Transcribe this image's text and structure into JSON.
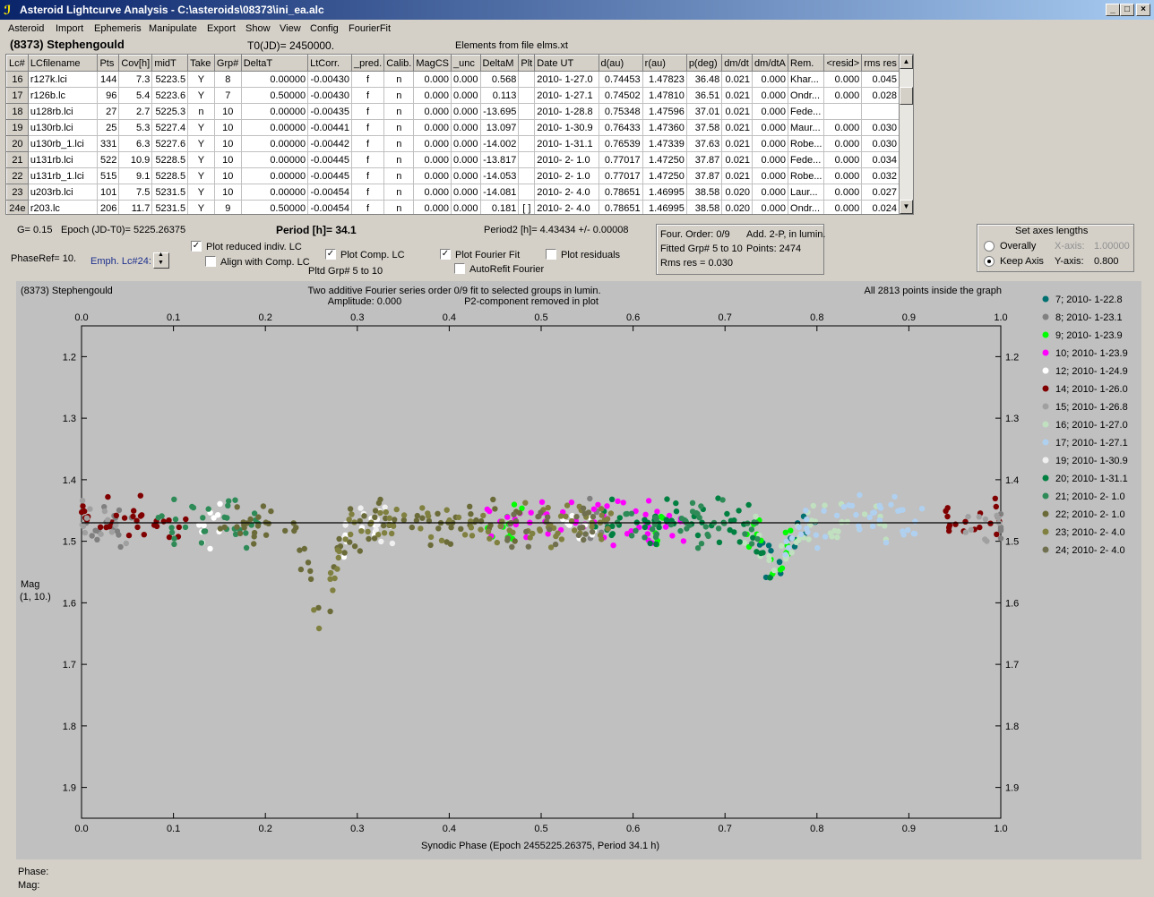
{
  "window": {
    "title": "Asteroid Lightcurve Analysis - C:\\asteroids\\08373\\ini_ea.alc",
    "min_label": "_",
    "max_label": "□",
    "close_label": "×"
  },
  "menu": [
    "Asteroid",
    "Import",
    "Ephemeris",
    "Manipulate",
    "Export",
    "Show",
    "View",
    "Config",
    "FourierFit"
  ],
  "header": {
    "asteroid": "(8373) Stephengould",
    "t0": "T0(JD)= 2450000.",
    "elements": "Elements from file elms.xt"
  },
  "table": {
    "columns": [
      "Lc#",
      "LCfilename",
      "Pts",
      "Cov[h]",
      "midT",
      "Take",
      "Grp#",
      "DeltaT",
      "LtCorr.",
      "_pred.",
      "Calib.",
      "MagCS",
      "_unc",
      "DeltaM",
      "Plt",
      "Date UT",
      "d(au)",
      "r(au)",
      "p(deg)",
      "dm/dt",
      "dm/dtA",
      "Rem.",
      "<resid>",
      "rms res"
    ],
    "rows": [
      [
        "16",
        "r127k.lci",
        "144",
        "7.3",
        "5223.5",
        "Y",
        "8",
        "0.00000",
        "-0.00430",
        "f",
        "n",
        "0.000",
        "0.000",
        "0.568",
        "",
        "2010- 1-27.0",
        "0.74453",
        "1.47823",
        "36.48",
        "0.021",
        "0.000",
        "Khar...",
        "0.000",
        "0.045"
      ],
      [
        "17",
        "r126b.lc",
        "96",
        "5.4",
        "5223.6",
        "Y",
        "7",
        "0.50000",
        "-0.00430",
        "f",
        "n",
        "0.000",
        "0.000",
        "0.113",
        "",
        "2010- 1-27.1",
        "0.74502",
        "1.47810",
        "36.51",
        "0.021",
        "0.000",
        "Ondr...",
        "0.000",
        "0.028"
      ],
      [
        "18",
        "u128rb.lci",
        "27",
        "2.7",
        "5225.3",
        "n",
        "10",
        "0.00000",
        "-0.00435",
        "f",
        "n",
        "0.000",
        "0.000",
        "-13.695",
        "",
        "2010- 1-28.8",
        "0.75348",
        "1.47596",
        "37.01",
        "0.021",
        "0.000",
        "Fede...",
        "",
        ""
      ],
      [
        "19",
        "u130rb.lci",
        "25",
        "5.3",
        "5227.4",
        "Y",
        "10",
        "0.00000",
        "-0.00441",
        "f",
        "n",
        "0.000",
        "0.000",
        "13.097",
        "",
        "2010- 1-30.9",
        "0.76433",
        "1.47360",
        "37.58",
        "0.021",
        "0.000",
        "Maur...",
        "0.000",
        "0.030"
      ],
      [
        "20",
        "u130rb_1.lci",
        "331",
        "6.3",
        "5227.6",
        "Y",
        "10",
        "0.00000",
        "-0.00442",
        "f",
        "n",
        "0.000",
        "0.000",
        "-14.002",
        "",
        "2010- 1-31.1",
        "0.76539",
        "1.47339",
        "37.63",
        "0.021",
        "0.000",
        "Robe...",
        "0.000",
        "0.030"
      ],
      [
        "21",
        "u131rb.lci",
        "522",
        "10.9",
        "5228.5",
        "Y",
        "10",
        "0.00000",
        "-0.00445",
        "f",
        "n",
        "0.000",
        "0.000",
        "-13.817",
        "",
        "2010- 2- 1.0",
        "0.77017",
        "1.47250",
        "37.87",
        "0.021",
        "0.000",
        "Fede...",
        "0.000",
        "0.034"
      ],
      [
        "22",
        "u131rb_1.lci",
        "515",
        "9.1",
        "5228.5",
        "Y",
        "10",
        "0.00000",
        "-0.00445",
        "f",
        "n",
        "0.000",
        "0.000",
        "-14.053",
        "",
        "2010- 2- 1.0",
        "0.77017",
        "1.47250",
        "37.87",
        "0.021",
        "0.000",
        "Robe...",
        "0.000",
        "0.032"
      ],
      [
        "23",
        "u203rb.lci",
        "101",
        "7.5",
        "5231.5",
        "Y",
        "10",
        "0.00000",
        "-0.00454",
        "f",
        "n",
        "0.000",
        "0.000",
        "-14.081",
        "",
        "2010- 2- 4.0",
        "0.78651",
        "1.46995",
        "38.58",
        "0.020",
        "0.000",
        "Laur...",
        "0.000",
        "0.027"
      ],
      [
        "24e",
        "r203.lc",
        "206",
        "11.7",
        "5231.5",
        "Y",
        "9",
        "0.50000",
        "-0.00454",
        "f",
        "n",
        "0.000",
        "0.000",
        "0.181",
        "[ ]",
        "2010- 2- 4.0",
        "0.78651",
        "1.46995",
        "38.58",
        "0.020",
        "0.000",
        "Ondr...",
        "0.000",
        "0.024"
      ]
    ]
  },
  "controls": {
    "g": "G= 0.15",
    "epoch": "Epoch (JD-T0)= 5225.26375",
    "period": "Period [h]= 34.1",
    "period2": "Period2 [h]= 4.43434 +/- 0.00008",
    "phase_ref": "PhaseRef= 10.",
    "emph": "Emph. Lc#24:",
    "plot_reduced": "Plot reduced indiv. LC",
    "align_comp": "Align with Comp. LC",
    "plot_comp": "Plot Comp. LC",
    "pltd_grp": "Pltd Grp#  5  to  10",
    "plot_fourier": "Plot Fourier Fit",
    "autorefit": "AutoRefit Fourier",
    "plot_residuals": "Plot residuals",
    "four_order": "Four. Order:  0/9",
    "add_2p": "Add. 2-P, in lumin.",
    "fitted_grp": "Fitted Grp# 5 to 10",
    "points": "Points: 2474",
    "rms": "Rms res     = 0.030",
    "axes_title": "Set axes lengths",
    "overally": "Overally",
    "keep_axis": "Keep Axis",
    "xaxis_label": "X-axis:",
    "xaxis_value": "1.00000",
    "yaxis_label": "Y-axis:",
    "yaxis_value": "0.800"
  },
  "status": {
    "phase": "Phase:",
    "mag": "Mag:"
  },
  "chart_data": {
    "type": "scatter",
    "title": "(8373) Stephengould",
    "subtitle_1": "Two additive Fourier series order 0/9 fit to selected groups in lumin.",
    "subtitle_2": "Amplitude: 0.000",
    "subtitle_3": "P2-component removed in plot",
    "info_right": "All 2813 points inside the graph",
    "xlabel": "Synodic Phase (Epoch 2455225.26375, Period 34.1 h)",
    "ylabel": "Mag",
    "ylabel2": "(1, 10.)",
    "xlim": [
      0,
      1
    ],
    "ylim": [
      1.95,
      1.15
    ],
    "x_ticks": [
      "0.0",
      "0.1",
      "0.2",
      "0.3",
      "0.4",
      "0.5",
      "0.6",
      "0.7",
      "0.8",
      "0.9",
      "1.0"
    ],
    "y_ticks": [
      "1.2",
      "1.3",
      "1.4",
      "1.5",
      "1.6",
      "1.7",
      "1.8",
      "1.9"
    ],
    "fit_line_mag": 1.47,
    "series": [
      {
        "name": "7; 2010- 1-22.8",
        "color": "#007070",
        "x_ranges": [
          [
            0.73,
            0.8
          ]
        ]
      },
      {
        "name": "8; 2010- 1-23.1",
        "color": "#808080",
        "x_ranges": [
          [
            0.0,
            0.06
          ],
          [
            0.55,
            0.58
          ],
          [
            1.0,
            1.0
          ]
        ]
      },
      {
        "name": "9; 2010- 1-23.9",
        "color": "#00ff00",
        "x_ranges": [
          [
            0.44,
            0.48
          ],
          [
            0.62,
            0.64
          ],
          [
            0.72,
            0.78
          ]
        ]
      },
      {
        "name": "10; 2010- 1-23.9",
        "color": "#ff00ff",
        "x_ranges": [
          [
            0.44,
            0.66
          ]
        ]
      },
      {
        "name": "12; 2010- 1-24.9",
        "color": "#ffffff",
        "x_ranges": [
          [
            0.12,
            0.16
          ],
          [
            0.28,
            0.32
          ],
          [
            0.52,
            0.56
          ]
        ]
      },
      {
        "name": "14; 2010- 1-26.0",
        "color": "#800000",
        "x_ranges": [
          [
            0.0,
            0.12
          ],
          [
            0.93,
            1.0
          ]
        ]
      },
      {
        "name": "15; 2010- 1-26.8",
        "color": "#a0a0a0",
        "x_ranges": [
          [
            0.0,
            0.05
          ],
          [
            0.96,
            1.0
          ]
        ]
      },
      {
        "name": "16; 2010- 1-27.0",
        "color": "#c0e0c0",
        "x_ranges": [
          [
            0.72,
            0.88
          ]
        ]
      },
      {
        "name": "17; 2010- 1-27.1",
        "color": "#b0d0f0",
        "x_ranges": [
          [
            0.76,
            0.92
          ]
        ]
      },
      {
        "name": "19; 2010- 1-30.9",
        "color": "#f0f0f0",
        "x_ranges": [
          [
            0.28,
            0.34
          ]
        ]
      },
      {
        "name": "20; 2010- 1-31.1",
        "color": "#008040",
        "x_ranges": [
          [
            0.55,
            0.75
          ]
        ]
      },
      {
        "name": "21; 2010- 2- 1.0",
        "color": "#2e8b57",
        "x_ranges": [
          [
            0.08,
            0.2
          ],
          [
            0.58,
            0.74
          ]
        ]
      },
      {
        "name": "22; 2010- 2- 1.0",
        "color": "#6b6b3a",
        "x_ranges": [
          [
            0.15,
            0.48
          ]
        ]
      },
      {
        "name": "23; 2010- 2- 4.0",
        "color": "#808040",
        "x_ranges": [
          [
            0.25,
            0.58
          ]
        ]
      },
      {
        "name": "24; 2010- 2- 4.0",
        "color": "#707050",
        "x_ranges": [
          [
            0.46,
            0.56
          ]
        ]
      }
    ]
  }
}
